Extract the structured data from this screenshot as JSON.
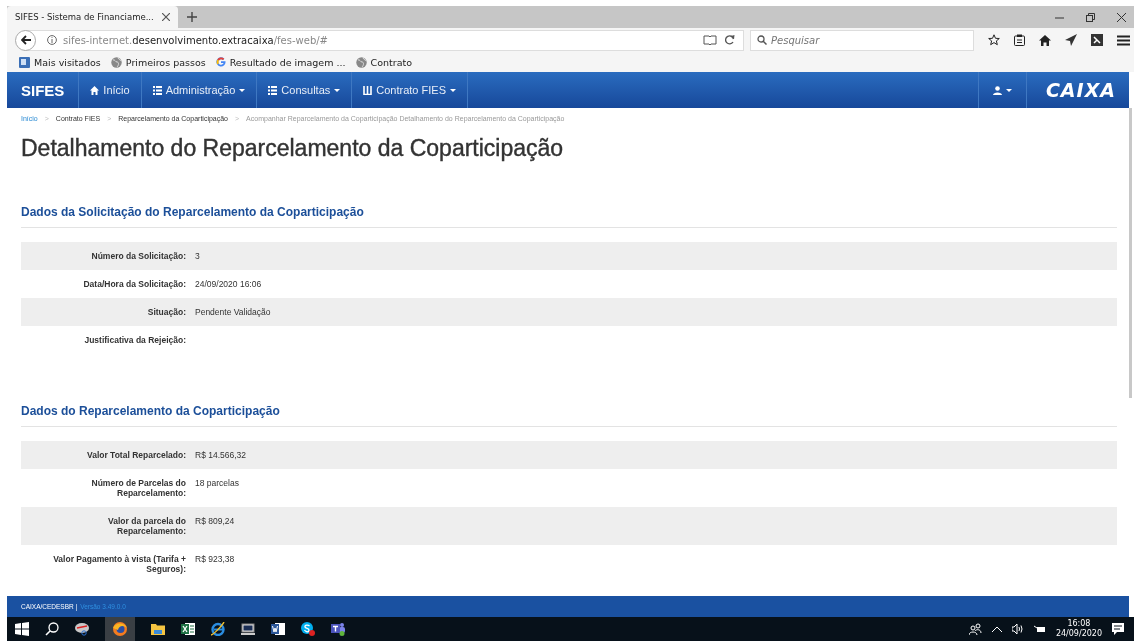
{
  "browser": {
    "tab_title": "SIFES - Sistema de Financiame...",
    "url": {
      "prefix": "sifes-internet.",
      "domain": "desenvolvimento.extracaixa",
      "path": "/fes-web/#"
    },
    "search_placeholder": "Pesquisar",
    "bookmarks": [
      {
        "label": "Mais visitados",
        "kind": "folder"
      },
      {
        "label": "Primeiros passos",
        "kind": "globe"
      },
      {
        "label": "Resultado de imagem ...",
        "kind": "google"
      },
      {
        "label": "Contrato",
        "kind": "globe"
      }
    ]
  },
  "navbar": {
    "brand": "SIFES",
    "items": [
      {
        "label": "Início",
        "kind": "home",
        "dropdown": false
      },
      {
        "label": "Administração",
        "kind": "list",
        "dropdown": true
      },
      {
        "label": "Consultas",
        "kind": "list",
        "dropdown": true
      },
      {
        "label": "Contrato FIES",
        "kind": "columns",
        "dropdown": true
      }
    ],
    "logo": "CAIXA"
  },
  "breadcrumb": [
    {
      "label": "Início",
      "kind": "link"
    },
    {
      "label": ">",
      "kind": "separator"
    },
    {
      "label": "Contrato FIES",
      "kind": "item"
    },
    {
      "label": ">",
      "kind": "separator"
    },
    {
      "label": "Reparcelamento da Coparticipação",
      "kind": "item"
    },
    {
      "label": ">",
      "kind": "separator"
    },
    {
      "label": "Acompanhar Reparcelamento da Coparticipação Detalhamento do Reparcelamento da Coparticipação",
      "kind": "current"
    }
  ],
  "title": "Detalhamento do Reparcelamento da Coparticipação",
  "sections": [
    {
      "heading": "Dados da Solicitação do Reparcelamento da Coparticipação",
      "rows": [
        {
          "label": "Número da Solicitação:",
          "value": "3"
        },
        {
          "label": "Data/Hora da Solicitação:",
          "value": "24/09/2020 16:06"
        },
        {
          "label": "Situação:",
          "value": "Pendente Validação"
        },
        {
          "label": "Justificativa da Rejeição:"
        }
      ]
    },
    {
      "heading": "Dados do Reparcelamento da Coparticipação",
      "rows": [
        {
          "label": "Valor Total Reparcelado:",
          "value": "R$ 14.566,32"
        },
        {
          "label": "Número de Parcelas do Reparcelamento:",
          "value": "18 parcelas"
        },
        {
          "label": "Valor da parcela do Reparcelamento:",
          "value": "R$ 809,24"
        },
        {
          "label": "Valor Pagamento à  vista (Tarifa + Seguros):",
          "value": "R$ 923,38"
        }
      ]
    }
  ],
  "footer": {
    "org": "CAIXA/CEDESBR |",
    "version": "Versão 3.49.0.0"
  },
  "taskbar": {
    "time": "16:08",
    "date": "24/09/2020"
  }
}
